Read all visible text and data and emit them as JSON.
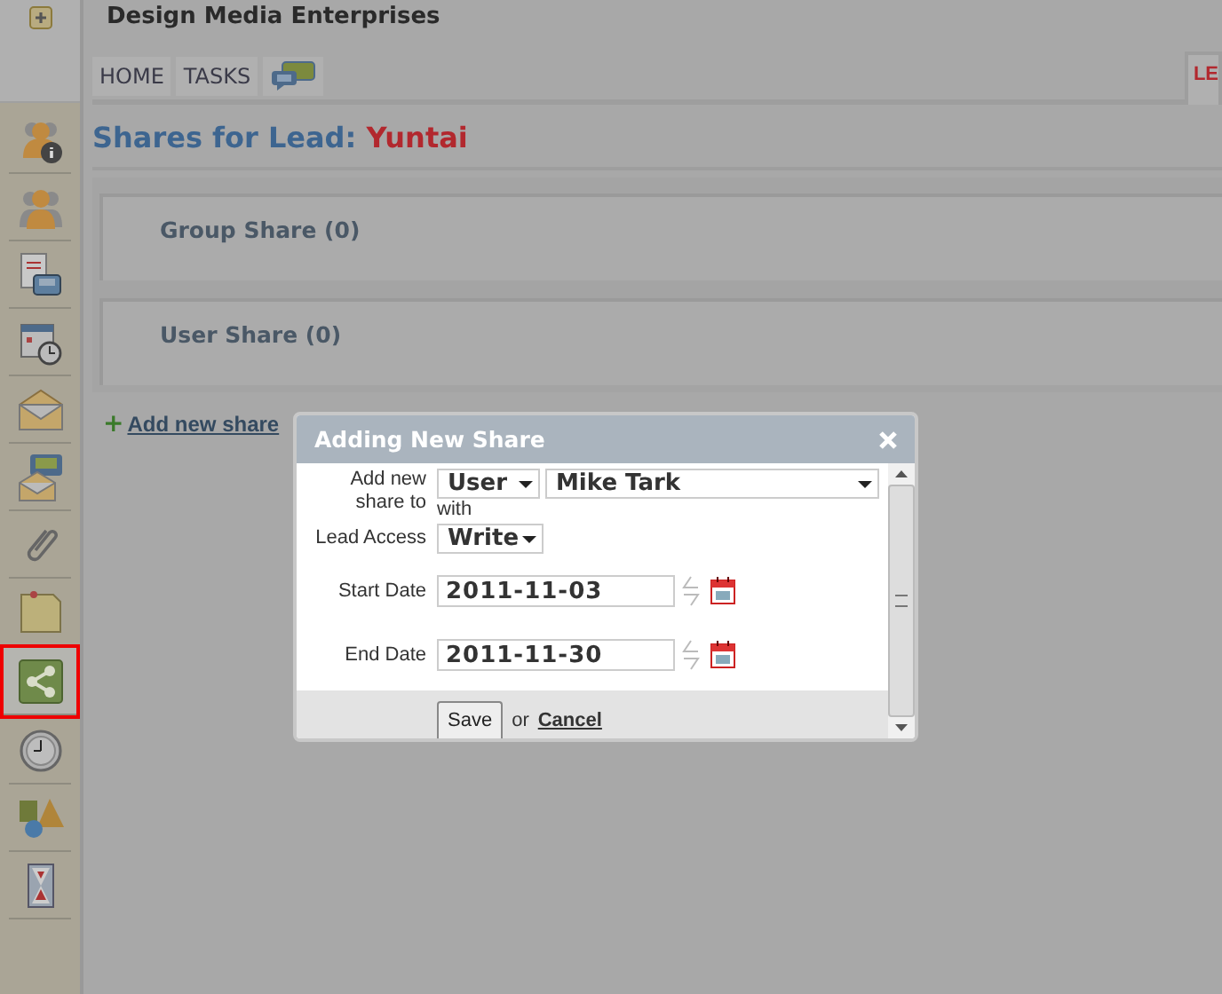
{
  "company": "Design Media Enterprises",
  "tabs": [
    {
      "kind": "text",
      "label": "HOME",
      "selected": false
    },
    {
      "kind": "text",
      "label": "TASKS",
      "selected": false
    },
    {
      "kind": "chat",
      "selected": false
    },
    {
      "kind": "text",
      "label": "LE",
      "selected": true
    }
  ],
  "sidebar": {
    "items": [
      {
        "kind": "lead-info",
        "selected": false
      },
      {
        "kind": "people",
        "selected": false
      },
      {
        "kind": "phone-doc",
        "selected": false
      },
      {
        "kind": "calendar",
        "selected": false
      },
      {
        "kind": "envelope",
        "selected": false
      },
      {
        "kind": "envelope-chat",
        "selected": false
      },
      {
        "kind": "paperclip",
        "selected": false
      },
      {
        "kind": "note",
        "selected": false
      },
      {
        "kind": "share",
        "selected": true
      },
      {
        "kind": "clock",
        "selected": false
      },
      {
        "kind": "shapes",
        "selected": false
      },
      {
        "kind": "hourglass",
        "selected": false
      }
    ]
  },
  "heading": {
    "prefix": "Shares for Lead:",
    "name": "Yuntai"
  },
  "sections": [
    {
      "title": "Group Share (0)"
    },
    {
      "title": "User Share (0)"
    }
  ],
  "add_link": {
    "icon": "+",
    "label": "Add new share"
  },
  "dialog": {
    "title": "Adding New Share",
    "share_to": {
      "label": "Add new share to",
      "type": "User",
      "person": "Mike Tark",
      "with": "with"
    },
    "access": {
      "label": "Lead Access",
      "value": "Write"
    },
    "dates": [
      {
        "label": "Start Date",
        "value": "2011-11-03"
      },
      {
        "label": "End Date",
        "value": "2011-11-30"
      }
    ],
    "save": "Save",
    "or": "or",
    "cancel": "Cancel"
  }
}
